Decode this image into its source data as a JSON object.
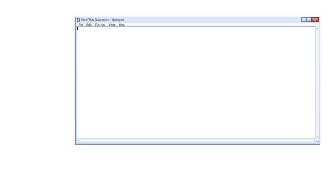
{
  "window": {
    "title": "New Text Document - Notepad",
    "caption_buttons": {
      "minimize": "–",
      "maximize": "□",
      "close": "x"
    }
  },
  "menubar": {
    "items": [
      "File",
      "Edit",
      "Format",
      "View",
      "Help"
    ]
  },
  "editor": {
    "content": ""
  },
  "scrollbars": {
    "up_arrow": "▴",
    "down_arrow": "▾",
    "left_arrow": "◂",
    "right_arrow": "▸"
  }
}
